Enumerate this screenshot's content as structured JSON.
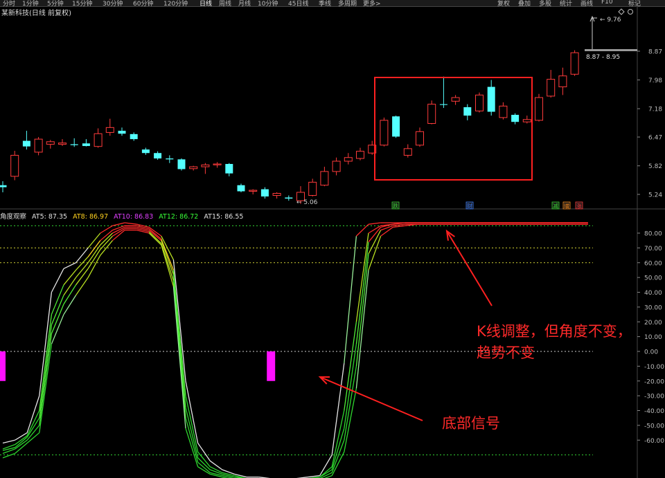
{
  "toolbar": {
    "tabs": [
      "分时",
      "1分钟",
      "5分钟",
      "15分钟",
      "30分钟",
      "60分钟",
      "120分钟",
      "日线",
      "周线",
      "月线",
      "10分钟",
      "45日线",
      "季线",
      "多周期",
      "更多>"
    ],
    "active": "日线",
    "right": [
      "复权",
      "叠加",
      "多股",
      "统计",
      "画线",
      "F10",
      "标记"
    ]
  },
  "stock_title": "某新科技(日线 前复权)",
  "price_labels": {
    "high": "9.76",
    "low": "5.06",
    "range": "8.87 - 8.95"
  },
  "markers": [
    {
      "text": "跌",
      "color": "#36d62f"
    },
    {
      "text": "财",
      "color": "#3a7dff"
    },
    {
      "text": "减",
      "color": "#36d62f"
    },
    {
      "text": "增",
      "color": "#ff8c1a"
    },
    {
      "text": "涨",
      "color": "#ff3a3a"
    }
  ],
  "indicator": {
    "name": "角度观察",
    "items": [
      {
        "label": "AT5: 87.35",
        "color": "#e0e0e0"
      },
      {
        "label": "AT8: 86.97",
        "color": "#ffd21f"
      },
      {
        "label": "AT10: 86.83",
        "color": "#e040ff"
      },
      {
        "label": "AT12: 86.72",
        "color": "#38ff38"
      },
      {
        "label": "AT15: 86.55",
        "color": "#e0e0e0"
      }
    ]
  },
  "annotations": {
    "line1": "K线调整，但角度不变，",
    "line2": "趋势不变",
    "bottom": "底部信号"
  },
  "chart_data": [
    {
      "type": "candlestick",
      "yticks": [
        5.24,
        5.82,
        6.47,
        7.18,
        7.98,
        8.87
      ],
      "candles": [
        {
          "o": 5.42,
          "h": 5.5,
          "l": 5.28,
          "c": 5.38
        },
        {
          "o": 5.6,
          "h": 6.15,
          "l": 5.52,
          "c": 6.05
        },
        {
          "o": 6.38,
          "h": 6.62,
          "l": 6.18,
          "c": 6.25
        },
        {
          "o": 6.12,
          "h": 6.47,
          "l": 6.05,
          "c": 6.42
        },
        {
          "o": 6.3,
          "h": 6.4,
          "l": 6.2,
          "c": 6.36
        },
        {
          "o": 6.3,
          "h": 6.42,
          "l": 6.26,
          "c": 6.33
        },
        {
          "o": 6.3,
          "h": 6.44,
          "l": 6.24,
          "c": 6.28
        },
        {
          "o": 6.32,
          "h": 6.42,
          "l": 6.25,
          "c": 6.26
        },
        {
          "o": 6.25,
          "h": 6.68,
          "l": 6.22,
          "c": 6.55
        },
        {
          "o": 6.58,
          "h": 6.92,
          "l": 6.5,
          "c": 6.7
        },
        {
          "o": 6.62,
          "h": 6.7,
          "l": 6.5,
          "c": 6.55
        },
        {
          "o": 6.54,
          "h": 6.58,
          "l": 6.38,
          "c": 6.42
        },
        {
          "o": 6.18,
          "h": 6.22,
          "l": 6.06,
          "c": 6.1
        },
        {
          "o": 6.1,
          "h": 6.14,
          "l": 5.95,
          "c": 5.98
        },
        {
          "o": 5.98,
          "h": 6.05,
          "l": 5.88,
          "c": 5.96
        },
        {
          "o": 5.96,
          "h": 5.98,
          "l": 5.72,
          "c": 5.75
        },
        {
          "o": 5.76,
          "h": 5.82,
          "l": 5.72,
          "c": 5.8
        },
        {
          "o": 5.8,
          "h": 5.88,
          "l": 5.65,
          "c": 5.84
        },
        {
          "o": 5.84,
          "h": 5.9,
          "l": 5.78,
          "c": 5.86
        },
        {
          "o": 5.86,
          "h": 5.88,
          "l": 5.6,
          "c": 5.66
        },
        {
          "o": 5.42,
          "h": 5.45,
          "l": 5.28,
          "c": 5.3
        },
        {
          "o": 5.3,
          "h": 5.34,
          "l": 5.24,
          "c": 5.32
        },
        {
          "o": 5.34,
          "h": 5.38,
          "l": 5.16,
          "c": 5.2
        },
        {
          "o": 5.22,
          "h": 5.28,
          "l": 5.16,
          "c": 5.26
        },
        {
          "o": 5.18,
          "h": 5.22,
          "l": 5.12,
          "c": 5.16
        },
        {
          "o": 5.12,
          "h": 5.4,
          "l": 5.06,
          "c": 5.28
        },
        {
          "o": 5.22,
          "h": 5.55,
          "l": 5.2,
          "c": 5.48
        },
        {
          "o": 5.42,
          "h": 5.8,
          "l": 5.4,
          "c": 5.7
        },
        {
          "o": 5.7,
          "h": 6.0,
          "l": 5.62,
          "c": 5.92
        },
        {
          "o": 5.92,
          "h": 6.1,
          "l": 5.85,
          "c": 6.0
        },
        {
          "o": 5.98,
          "h": 6.22,
          "l": 5.94,
          "c": 6.14
        },
        {
          "o": 6.1,
          "h": 6.38,
          "l": 6.06,
          "c": 6.28
        },
        {
          "o": 6.28,
          "h": 6.95,
          "l": 6.25,
          "c": 6.88
        },
        {
          "o": 6.98,
          "h": 7.0,
          "l": 6.45,
          "c": 6.48
        },
        {
          "o": 6.05,
          "h": 6.3,
          "l": 6.0,
          "c": 6.2
        },
        {
          "o": 6.28,
          "h": 6.7,
          "l": 6.24,
          "c": 6.6
        },
        {
          "o": 6.8,
          "h": 7.4,
          "l": 6.78,
          "c": 7.3
        },
        {
          "o": 7.3,
          "h": 8.08,
          "l": 7.2,
          "c": 7.28
        },
        {
          "o": 7.38,
          "h": 7.55,
          "l": 7.28,
          "c": 7.48
        },
        {
          "o": 7.22,
          "h": 7.3,
          "l": 6.88,
          "c": 7.0
        },
        {
          "o": 7.12,
          "h": 7.62,
          "l": 7.08,
          "c": 7.55
        },
        {
          "o": 7.78,
          "h": 7.98,
          "l": 7.0,
          "c": 7.1
        },
        {
          "o": 6.95,
          "h": 7.35,
          "l": 6.9,
          "c": 7.25
        },
        {
          "o": 7.02,
          "h": 7.06,
          "l": 6.78,
          "c": 6.84
        },
        {
          "o": 6.84,
          "h": 7.0,
          "l": 6.8,
          "c": 6.9
        },
        {
          "o": 6.88,
          "h": 7.58,
          "l": 6.85,
          "c": 7.48
        },
        {
          "o": 7.52,
          "h": 8.28,
          "l": 7.48,
          "c": 8.0
        },
        {
          "o": 7.78,
          "h": 8.35,
          "l": 7.55,
          "c": 8.1
        },
        {
          "o": 8.15,
          "h": 8.9,
          "l": 8.1,
          "c": 8.82
        }
      ]
    },
    {
      "type": "line",
      "yticks": [
        80,
        70,
        60,
        50,
        40,
        30,
        20,
        10,
        0,
        -10,
        -20,
        -30,
        -40,
        -50,
        -60
      ],
      "ylim": [
        -85,
        91
      ],
      "dashed_levels": [
        85,
        70,
        60,
        0,
        -70
      ],
      "x": [
        0,
        1,
        2,
        3,
        4,
        5,
        6,
        7,
        8,
        9,
        10,
        11,
        12,
        13,
        14,
        15,
        16,
        17,
        18,
        19,
        20,
        21,
        22,
        23,
        24,
        25,
        26,
        27,
        28,
        29,
        30,
        31,
        32,
        33,
        34,
        35,
        36,
        37,
        38,
        39,
        40,
        41,
        42,
        43,
        44,
        45,
        46,
        47,
        48
      ],
      "series": [
        {
          "name": "AT5",
          "color": "#e0e0e0",
          "values": [
            -62,
            -60,
            -55,
            -30,
            40,
            56,
            60,
            70,
            80,
            85,
            87,
            86,
            84,
            78,
            62,
            -20,
            -62,
            -74,
            -80,
            -83,
            -85,
            -85,
            -86,
            -86,
            -86,
            -85,
            -84,
            -70,
            -8,
            78,
            86,
            87,
            87,
            87,
            87,
            87,
            87,
            87,
            87,
            87,
            87,
            87,
            87,
            87,
            87,
            87,
            87,
            87,
            87
          ]
        },
        {
          "name": "AT8",
          "color": "#ffd21f",
          "values": [
            -66,
            -63,
            -57,
            -40,
            25,
            45,
            55,
            64,
            75,
            82,
            85,
            85,
            83,
            76,
            55,
            -30,
            -68,
            -78,
            -82,
            -84,
            -86,
            -86,
            -86,
            -86,
            -86,
            -86,
            -85,
            -78,
            -40,
            20,
            80,
            85,
            86,
            87,
            87,
            87,
            87,
            87,
            87,
            87,
            87,
            87,
            87,
            87,
            87,
            87,
            87,
            87,
            87
          ]
        },
        {
          "name": "AT10",
          "color": "#e040ff",
          "values": [
            -67,
            -65,
            -58,
            -45,
            18,
            38,
            50,
            60,
            72,
            80,
            84,
            84,
            82,
            75,
            52,
            -38,
            -72,
            -80,
            -83,
            -85,
            -86,
            -86,
            -87,
            -87,
            -86,
            -86,
            -85,
            -80,
            -52,
            5,
            74,
            84,
            86,
            87,
            87,
            87,
            87,
            87,
            87,
            87,
            87,
            87,
            87,
            87,
            87,
            87,
            87,
            87,
            87
          ]
        },
        {
          "name": "AT12",
          "color": "#38ff38",
          "values": [
            -69,
            -66,
            -60,
            -50,
            12,
            32,
            45,
            56,
            69,
            78,
            83,
            83,
            81,
            73,
            48,
            -45,
            -75,
            -82,
            -84,
            -86,
            -87,
            -87,
            -87,
            -87,
            -87,
            -86,
            -86,
            -82,
            -60,
            -10,
            66,
            82,
            85,
            86,
            86,
            86,
            86,
            86,
            86,
            86,
            86,
            86,
            86,
            86,
            86,
            86,
            86,
            86,
            86
          ]
        },
        {
          "name": "AT15",
          "color": "#e0e0e0",
          "values": [
            -72,
            -69,
            -62,
            -55,
            5,
            25,
            38,
            50,
            65,
            75,
            82,
            82,
            80,
            72,
            44,
            -52,
            -78,
            -83,
            -85,
            -87,
            -88,
            -88,
            -88,
            -88,
            -88,
            -87,
            -87,
            -84,
            -68,
            -25,
            55,
            78,
            84,
            85,
            86,
            86,
            86,
            86,
            86,
            86,
            86,
            86,
            86,
            86,
            86,
            86,
            86,
            86,
            86
          ]
        }
      ],
      "signal_bars": [
        {
          "x": 0,
          "from": -20,
          "to": 0
        },
        {
          "x": 22,
          "from": -20,
          "to": 0
        }
      ]
    }
  ]
}
